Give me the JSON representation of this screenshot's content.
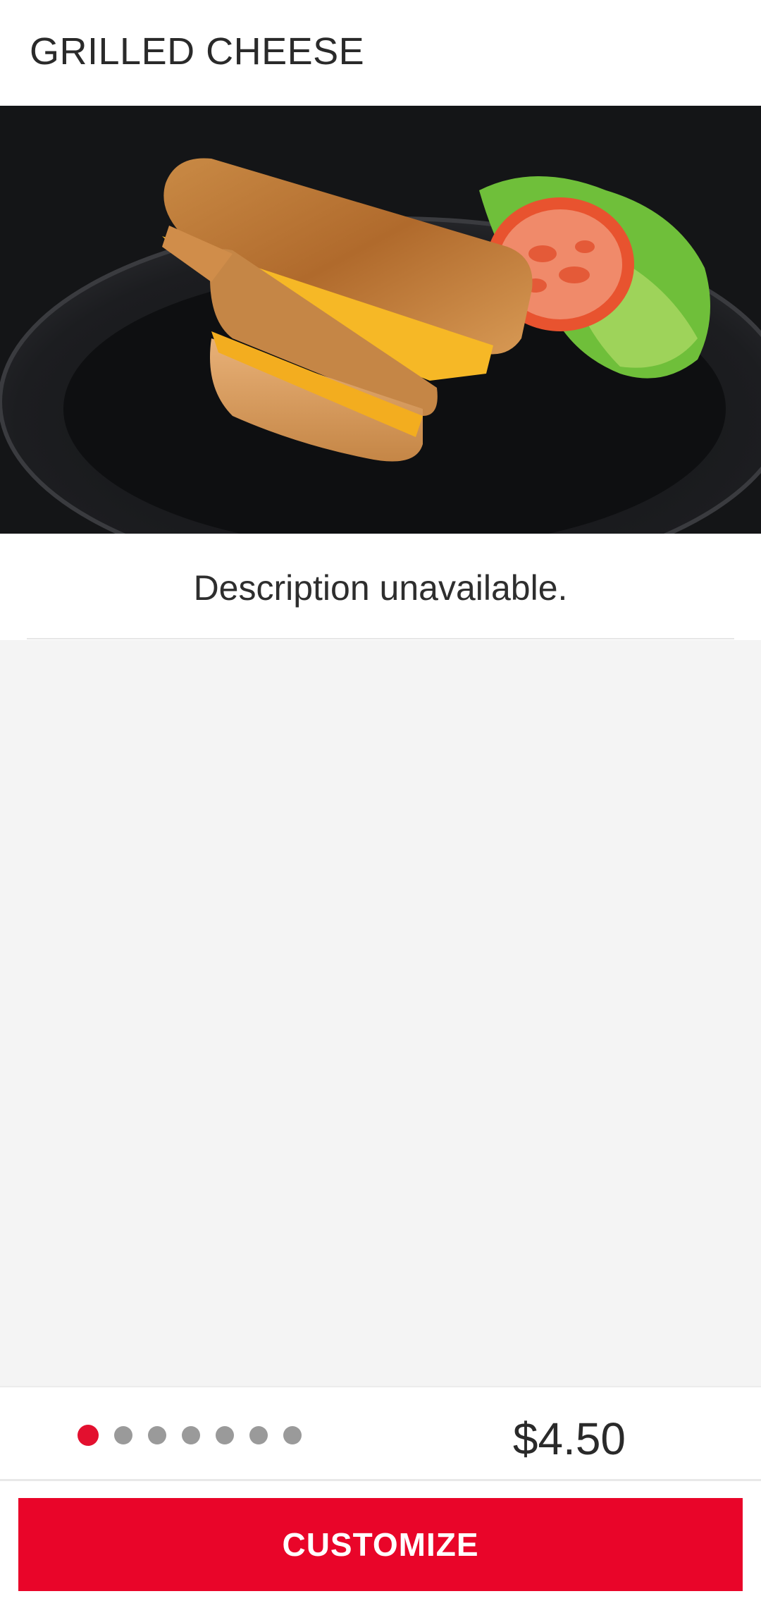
{
  "header": {
    "title": "GRILLED CHEESE"
  },
  "hero": {
    "image_description_name": "grilled-cheese-photo"
  },
  "description": {
    "text": "Description unavailable."
  },
  "pager": {
    "total": 7,
    "active_index": 0,
    "active_color": "#e3102f",
    "inactive_color": "#9a9a9a"
  },
  "price": {
    "text": "$4.50"
  },
  "cta": {
    "label": "CUSTOMIZE",
    "color": "#e90529"
  }
}
